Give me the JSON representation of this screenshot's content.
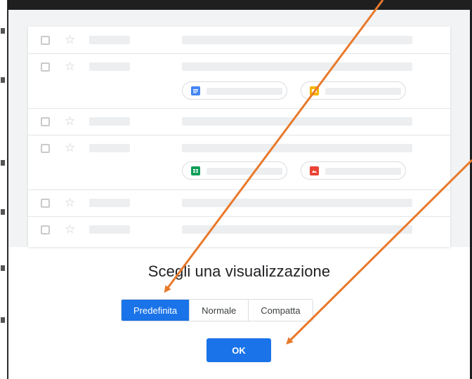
{
  "dialog": {
    "title": "Scegli una visualizzazione",
    "density_options": [
      {
        "label": "Predefinita",
        "selected": true
      },
      {
        "label": "Normale",
        "selected": false
      },
      {
        "label": "Compatta",
        "selected": false
      }
    ],
    "ok_label": "OK"
  },
  "preview": {
    "attachments": [
      "docs-icon",
      "slides-icon",
      "sheets-icon",
      "photo-icon"
    ]
  },
  "colors": {
    "accent": "#1a73e8",
    "annotation_arrow": "#e8792b",
    "docs": "#4285f4",
    "slides": "#f4b400",
    "sheets": "#0f9d58",
    "photo": "#ea4335"
  }
}
